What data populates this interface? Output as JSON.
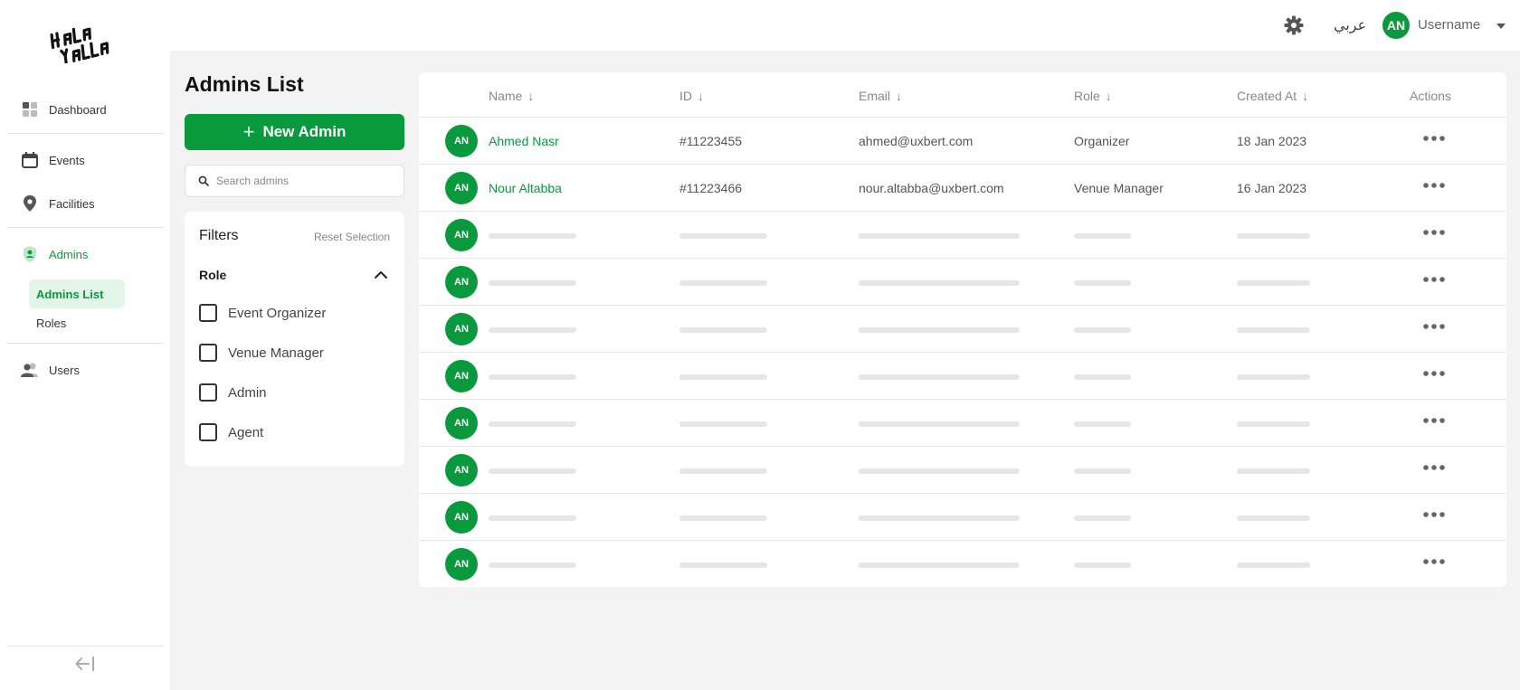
{
  "sidebar": {
    "items": [
      {
        "label": "Dashboard",
        "icon": "dashboard-icon"
      },
      {
        "label": "Events",
        "icon": "calendar-icon"
      },
      {
        "label": "Facilities",
        "icon": "location-pin-icon"
      },
      {
        "label": "Admins",
        "icon": "shield-user-icon",
        "active": true
      },
      {
        "label": "Users",
        "icon": "users-icon"
      }
    ],
    "sub_items": [
      {
        "label": "Admins List",
        "active": true
      },
      {
        "label": "Roles"
      }
    ]
  },
  "topbar": {
    "language": "عربي",
    "avatar_initials": "AN",
    "username": "Username"
  },
  "page": {
    "title": "Admins List",
    "new_button_label": "New Admin",
    "search_placeholder": "Search admins"
  },
  "filters": {
    "title": "Filters",
    "reset_label": "Reset Selection",
    "role_label": "Role",
    "options": [
      "Event Organizer",
      "Venue Manager",
      "Admin",
      "Agent"
    ]
  },
  "table": {
    "columns": [
      "Name",
      "ID",
      "Email",
      "Role",
      "Created At",
      "Actions"
    ],
    "rows": [
      {
        "initials": "AN",
        "name": "Ahmed Nasr",
        "id": "#11223455",
        "email": "ahmed@uxbert.com",
        "role": "Organizer",
        "created": "18 Jan 2023"
      },
      {
        "initials": "AN",
        "name": "Nour Altabba",
        "id": "#11223466",
        "email": "nour.altabba@uxbert.com",
        "role": "Venue Manager",
        "created": "16 Jan 2023"
      }
    ],
    "placeholder_row_initials": "AN",
    "placeholder_row_count": 8
  },
  "colors": {
    "accent": "#0a9a3e",
    "accent_light": "#e3f5e8",
    "background": "#f3f3f3"
  }
}
